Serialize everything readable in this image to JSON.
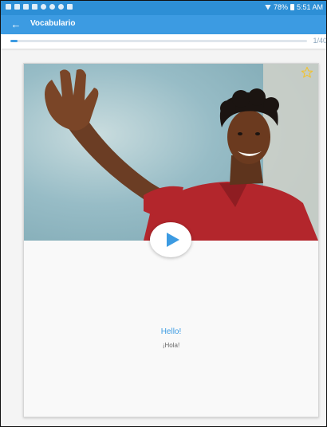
{
  "status_bar": {
    "battery_text": "78%",
    "time": "5:51 AM"
  },
  "app_bar": {
    "back_icon": "arrow-left-icon",
    "title": "Vocabulario"
  },
  "progress": {
    "current": 1,
    "total": 40,
    "label": "1/40"
  },
  "card": {
    "image_alt": "smiling man waving",
    "favorite_icon": "star-outline-icon",
    "play_icon": "play-icon",
    "word": "Hello!",
    "translation": "¡Hola!"
  },
  "colors": {
    "primary": "#3c9be2",
    "status_bar": "#2d8fd6",
    "star": "#f2c230"
  }
}
